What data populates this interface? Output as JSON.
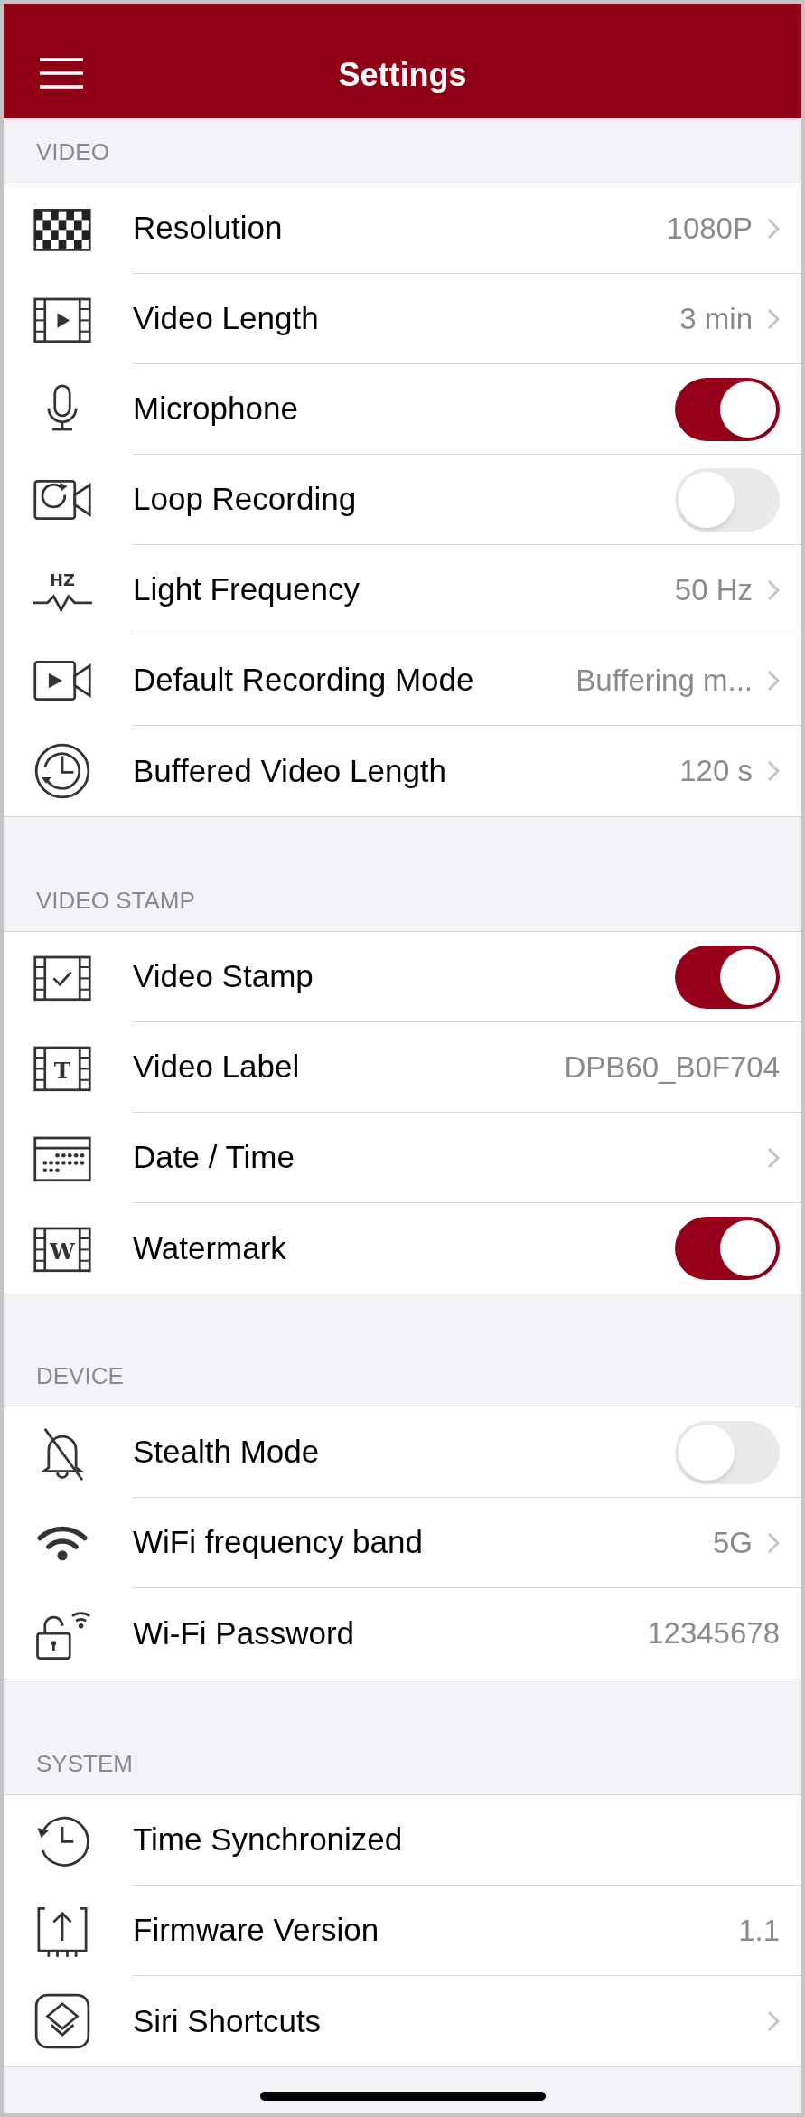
{
  "header": {
    "title": "Settings"
  },
  "sections": [
    {
      "title": "VIDEO",
      "rows": [
        {
          "kind": "value",
          "label": "Resolution",
          "value": "1080P",
          "chevron": true
        },
        {
          "kind": "value",
          "label": "Video Length",
          "value": "3 min",
          "chevron": true
        },
        {
          "kind": "toggle",
          "label": "Microphone",
          "on": true
        },
        {
          "kind": "toggle",
          "label": "Loop Recording",
          "on": false
        },
        {
          "kind": "value",
          "label": "Light Frequency",
          "value": "50 Hz",
          "chevron": true,
          "icon_label": "HZ"
        },
        {
          "kind": "value",
          "label": "Default Recording Mode",
          "value": "Buffering m...",
          "chevron": true
        },
        {
          "kind": "value",
          "label": "Buffered Video Length",
          "value": "120 s",
          "chevron": true
        }
      ]
    },
    {
      "title": "VIDEO STAMP",
      "rows": [
        {
          "kind": "toggle",
          "label": "Video Stamp",
          "on": true
        },
        {
          "kind": "value",
          "label": "Video Label",
          "value": "DPB60_B0F704",
          "chevron": false,
          "icon_label": "T"
        },
        {
          "kind": "value",
          "label": "Date / Time",
          "chevron": true
        },
        {
          "kind": "toggle",
          "label": "Watermark",
          "on": true,
          "icon_label": "W"
        }
      ]
    },
    {
      "title": "DEVICE",
      "rows": [
        {
          "kind": "toggle",
          "label": "Stealth Mode",
          "on": false
        },
        {
          "kind": "value",
          "label": "WiFi frequency band",
          "value": "5G",
          "chevron": true
        },
        {
          "kind": "value",
          "label": "Wi-Fi Password",
          "value": "12345678",
          "chevron": false
        }
      ]
    },
    {
      "title": "SYSTEM",
      "rows": [
        {
          "kind": "value",
          "label": "Time Synchronized",
          "chevron": false
        },
        {
          "kind": "value",
          "label": "Firmware Version",
          "value": "1.1",
          "chevron": false
        },
        {
          "kind": "value",
          "label": "Siri Shortcuts",
          "chevron": true
        }
      ]
    }
  ]
}
